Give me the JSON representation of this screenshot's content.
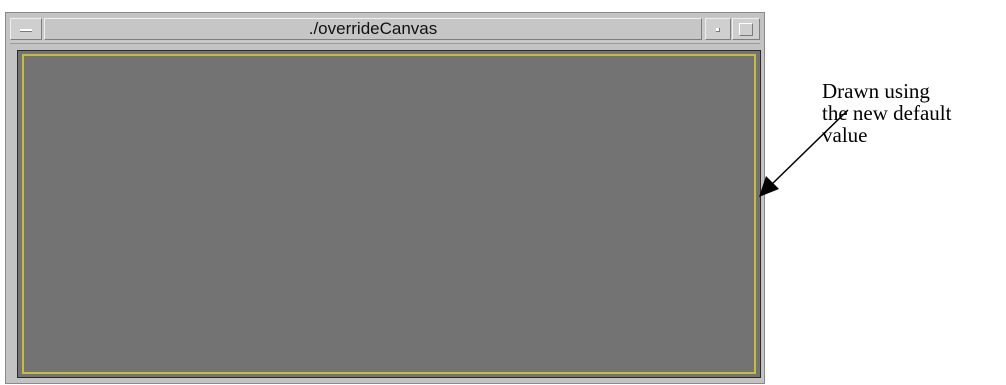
{
  "window": {
    "title": "./overrideCanvas"
  },
  "annotation": {
    "lines": [
      "Drawn using",
      "the new default",
      "value"
    ]
  },
  "colors": {
    "canvas_fill": "#737373",
    "canvas_border": "#c8bd3a"
  },
  "icons": {
    "window_menu": "window-menu-icon",
    "minimize": "minimize-icon",
    "maximize": "maximize-icon"
  }
}
